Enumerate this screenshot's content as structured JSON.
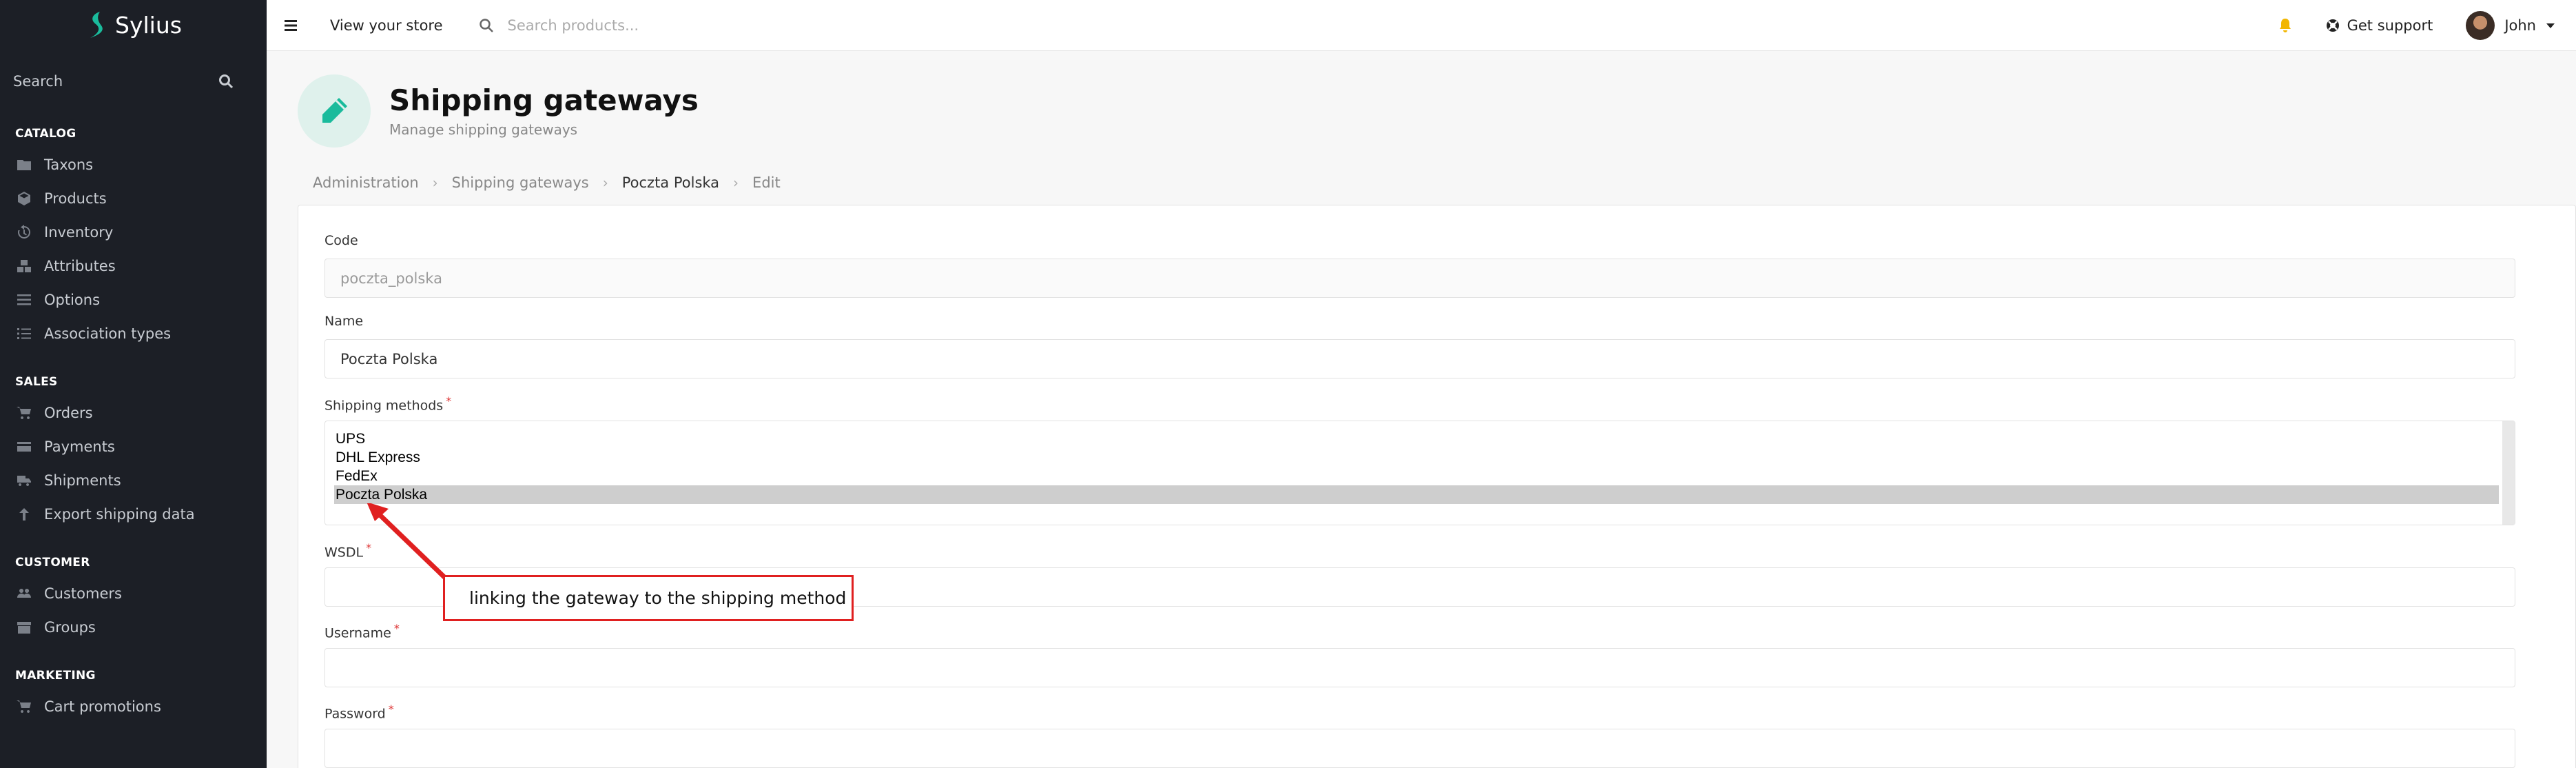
{
  "app": {
    "name": "Sylius",
    "brand_color": "#1abb9c"
  },
  "sidebar": {
    "search_label": "Search",
    "sections": [
      {
        "title": "CATALOG",
        "items": [
          {
            "label": "Taxons",
            "icon": "folder-icon"
          },
          {
            "label": "Products",
            "icon": "cube-icon"
          },
          {
            "label": "Inventory",
            "icon": "history-icon"
          },
          {
            "label": "Attributes",
            "icon": "cubes-icon"
          },
          {
            "label": "Options",
            "icon": "options-icon"
          },
          {
            "label": "Association types",
            "icon": "tasks-icon"
          }
        ]
      },
      {
        "title": "SALES",
        "items": [
          {
            "label": "Orders",
            "icon": "cart-icon"
          },
          {
            "label": "Payments",
            "icon": "payment-icon"
          },
          {
            "label": "Shipments",
            "icon": "truck-icon"
          },
          {
            "label": "Export shipping data",
            "icon": "arrow-up-icon"
          }
        ]
      },
      {
        "title": "CUSTOMER",
        "items": [
          {
            "label": "Customers",
            "icon": "users-icon"
          },
          {
            "label": "Groups",
            "icon": "archive-icon"
          }
        ]
      },
      {
        "title": "MARKETING",
        "items": [
          {
            "label": "Cart promotions",
            "icon": "cart-icon"
          }
        ]
      }
    ]
  },
  "topbar": {
    "view_store": "View your store",
    "search_placeholder": "Search products...",
    "support": "Get support",
    "user": "John"
  },
  "header": {
    "title": "Shipping gateways",
    "subtitle": "Manage shipping gateways"
  },
  "breadcrumb": [
    "Administration",
    "Shipping gateways",
    "Poczta Polska",
    "Edit"
  ],
  "form": {
    "code_label": "Code",
    "code_value": "poczta_polska",
    "name_label": "Name",
    "name_value": "Poczta Polska",
    "methods_label": "Shipping methods",
    "methods": [
      "UPS",
      "DHL Express",
      "FedEx",
      "Poczta Polska"
    ],
    "selected_method": "Poczta Polska",
    "wsdl_label": "WSDL",
    "wsdl_value": "",
    "username_label": "Username",
    "username_value": "",
    "password_label": "Password",
    "password_value": ""
  },
  "annotation": {
    "text": "linking the gateway to the shipping method",
    "color": "#e02020"
  }
}
